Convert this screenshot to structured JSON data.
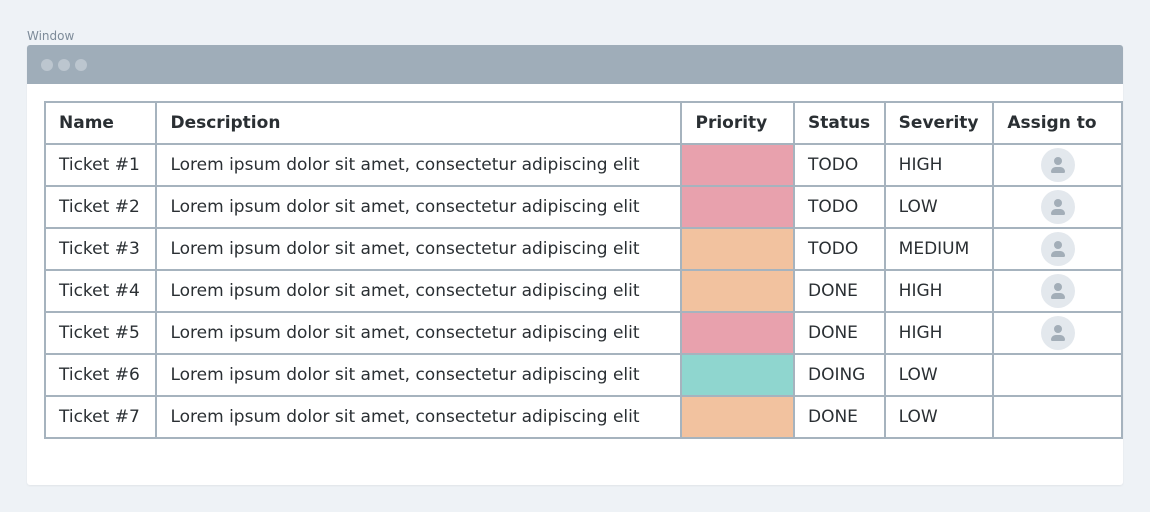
{
  "window": {
    "label": "Window"
  },
  "colors": {
    "high": "#e8a1ad",
    "medium": "#f2c29f",
    "low": "#8fd6cf"
  },
  "table": {
    "headers": {
      "name": "Name",
      "description": "Description",
      "priority": "Priority",
      "status": "Status",
      "severity": "Severity",
      "assign_to": "Assign to"
    },
    "rows": [
      {
        "name": "Ticket #1",
        "description": "Lorem ipsum dolor sit amet, consectetur adipiscing elit",
        "priority_color": "#e8a1ad",
        "status": "TODO",
        "severity": "HIGH",
        "assigned": true
      },
      {
        "name": "Ticket #2",
        "description": "Lorem ipsum dolor sit amet, consectetur adipiscing elit",
        "priority_color": "#e8a1ad",
        "status": "TODO",
        "severity": "LOW",
        "assigned": true
      },
      {
        "name": "Ticket #3",
        "description": "Lorem ipsum dolor sit amet, consectetur adipiscing elit",
        "priority_color": "#f2c29f",
        "status": "TODO",
        "severity": "MEDIUM",
        "assigned": true
      },
      {
        "name": "Ticket #4",
        "description": "Lorem ipsum dolor sit amet, consectetur adipiscing elit",
        "priority_color": "#f2c29f",
        "status": "DONE",
        "severity": "HIGH",
        "assigned": true
      },
      {
        "name": "Ticket #5",
        "description": "Lorem ipsum dolor sit amet, consectetur adipiscing elit",
        "priority_color": "#e8a1ad",
        "status": "DONE",
        "severity": "HIGH",
        "assigned": true
      },
      {
        "name": "Ticket #6",
        "description": "Lorem ipsum dolor sit amet, consectetur adipiscing elit",
        "priority_color": "#8fd6cf",
        "status": "DOING",
        "severity": "LOW",
        "assigned": false
      },
      {
        "name": "Ticket #7",
        "description": "Lorem ipsum dolor sit amet, consectetur adipiscing elit",
        "priority_color": "#f2c29f",
        "status": "DONE",
        "severity": "LOW",
        "assigned": false
      }
    ]
  }
}
